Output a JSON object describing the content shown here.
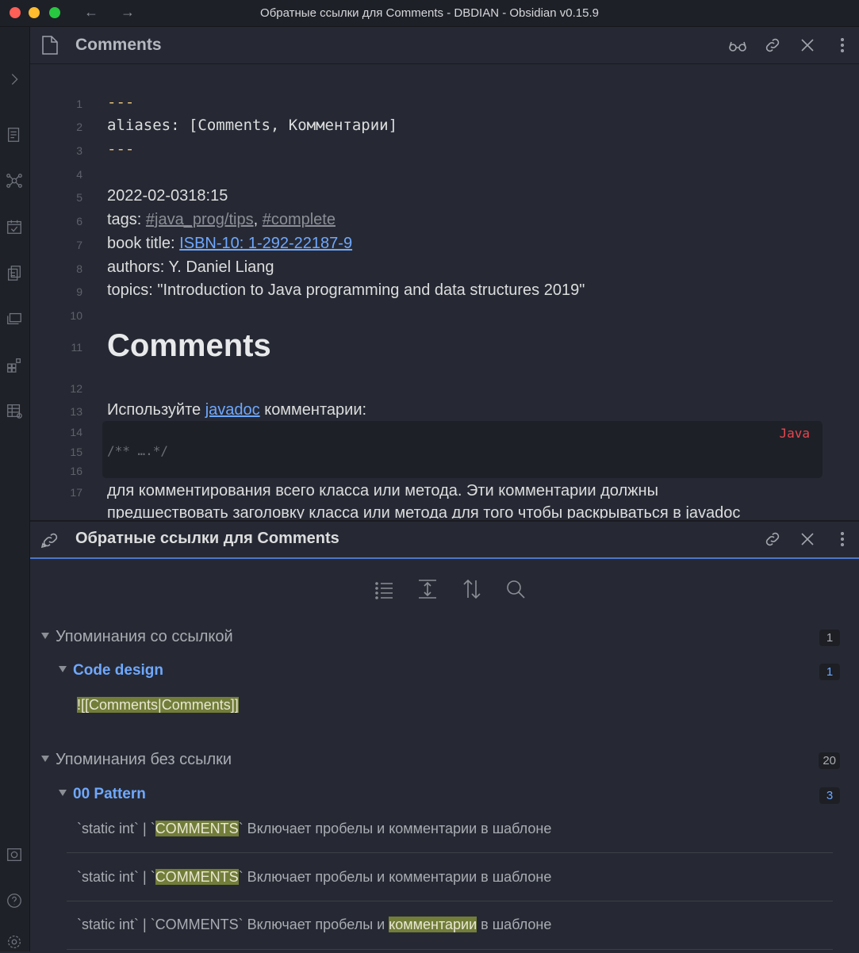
{
  "window": {
    "title": "Обратные ссылки для Comments - DBDIAN - Obsidian v0.15.9"
  },
  "editor": {
    "tab_title": "Comments",
    "lines": [
      {
        "n": "1",
        "text": "---"
      },
      {
        "n": "2",
        "key": "aliases:",
        "value": "[Comments, Комментарии]"
      },
      {
        "n": "3",
        "text": "---"
      },
      {
        "n": "4",
        "text": ""
      },
      {
        "n": "5",
        "text": "2022-02-0318:15"
      },
      {
        "n": "6",
        "prefix": "tags: ",
        "tag1": "#java_prog/tips",
        "sep": ", ",
        "tag2": "#complete"
      },
      {
        "n": "7",
        "prefix": "book title: ",
        "link": " ISBN-10: 1-292-22187-9"
      },
      {
        "n": "8",
        "text": "authors: Y. Daniel Liang"
      },
      {
        "n": "9",
        "text": "topics: \"Introduction to Java programming and data structures 2019\""
      },
      {
        "n": "10",
        "text": ""
      },
      {
        "n": "11",
        "text": "Comments"
      },
      {
        "n": "12",
        "text": ""
      },
      {
        "n": "13",
        "prefix": "Используйте ",
        "link": " javadoc",
        "suffix": " комментарии:"
      },
      {
        "n": "14",
        "text": ""
      },
      {
        "n": "15",
        "text": ""
      },
      {
        "n": "16",
        "text": ""
      },
      {
        "n": "17",
        "text": "для комментирования всего класса или метода. Эти комментарии должны"
      },
      {
        "n": "",
        "text": "предшествовать заголовку класса или метода для того чтобы раскрываться в javadoc"
      }
    ],
    "code_block": {
      "lang": "Java",
      "code": "/** ….*/"
    }
  },
  "backlinks": {
    "title": "Обратные ссылки для Comments",
    "linked": {
      "label": "Упоминания со ссылкой",
      "count": "1",
      "files": [
        {
          "name": "Code design",
          "count": "1",
          "snippet": "![[Comments|Comments]]"
        }
      ]
    },
    "unlinked": {
      "label": "Упоминания без ссылки",
      "count": "20",
      "files": [
        {
          "name": "00 Pattern",
          "count": "3",
          "snippets": [
            {
              "pre": "`static int` | `",
              "hl": "COMMENTS",
              "post": "` Включает пробелы и комментарии в шаблоне"
            },
            {
              "pre": "`static int` | `",
              "hl": "COMMENTS",
              "post": "` Включает пробелы и комментарии в шаблоне"
            },
            {
              "pre": "`static int` | `COMMENTS` Включает пробелы и ",
              "hl": "комментарии",
              "post": " в шаблоне"
            }
          ]
        }
      ]
    }
  },
  "icons": {
    "ribbon": [
      "chevron-right-icon",
      "outline-icon",
      "graph-icon",
      "daily-note-icon",
      "copy-icon",
      "slides-icon",
      "plugins-icon",
      "table-icon",
      "vault-icon",
      "help-icon",
      "settings-icon"
    ],
    "header": [
      "reading-glasses-icon",
      "link-icon",
      "close-icon",
      "more-icon"
    ],
    "toolbar": [
      "list-icon",
      "expand-icon",
      "sort-icon",
      "search-icon"
    ]
  },
  "colors": {
    "accent": "#4b76c9",
    "link": "#6fa8ff",
    "highlight": "#727d3a",
    "code_lang": "#e6474f",
    "frontmatter_dash": "#e5c07b"
  }
}
